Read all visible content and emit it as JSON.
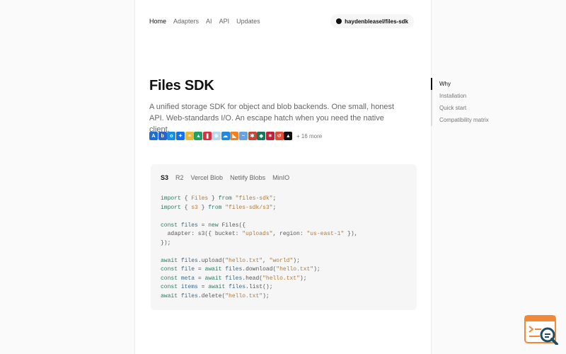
{
  "nav": {
    "items": [
      "Home",
      "Adapters",
      "AI",
      "API",
      "Updates"
    ],
    "repo": "haydenbleasel/files-sdk"
  },
  "hero": {
    "title": "Files SDK",
    "lead": "A unified storage SDK for object and blob backends. One small, honest API. Web-standards I/O. An escape hatch when you need the native client.",
    "more": "+ 16 more"
  },
  "adapter_icons": [
    {
      "name": "azure-icon",
      "color": "#1f6fd1",
      "glyph": "A"
    },
    {
      "name": "backblaze-icon",
      "color": "#2b63c9",
      "glyph": "b"
    },
    {
      "name": "box-icon",
      "color": "#1a8fe0",
      "glyph": "o"
    },
    {
      "name": "dropbox-icon",
      "color": "#1570ef",
      "glyph": "✦"
    },
    {
      "name": "files-icon",
      "color": "#e9b93b",
      "glyph": "≡"
    },
    {
      "name": "google-drive-icon",
      "color": "#24a060",
      "glyph": "▲"
    },
    {
      "name": "firebase-icon",
      "color": "#d9323b",
      "glyph": "❚"
    },
    {
      "name": "gcs-icon",
      "color": "#b8d8ef",
      "glyph": "⊛"
    },
    {
      "name": "cloud-icon",
      "color": "#1e88e5",
      "glyph": "☁"
    },
    {
      "name": "cloudflare-icon",
      "color": "#f38020",
      "glyph": "◣"
    },
    {
      "name": "onedrive-icon",
      "color": "#6aa3dc",
      "glyph": "~"
    },
    {
      "name": "oracle-icon",
      "color": "#c74634",
      "glyph": "✱"
    },
    {
      "name": "minio-icon",
      "color": "#16785a",
      "glyph": "◆"
    },
    {
      "name": "netlify-icon",
      "color": "#c21f39",
      "glyph": "✶"
    },
    {
      "name": "wasabi-icon",
      "color": "#e64b31",
      "glyph": "↺"
    },
    {
      "name": "vercel-icon",
      "color": "#111111",
      "glyph": "▲"
    }
  ],
  "code": {
    "tabs": [
      "S3",
      "R2",
      "Vercel Blob",
      "Netlify Blobs",
      "MinIO"
    ],
    "active_tab": "S3"
  },
  "toc": {
    "items": [
      "Why",
      "Installation",
      "Quick start",
      "Compatibility matrix"
    ],
    "active": "Why"
  }
}
